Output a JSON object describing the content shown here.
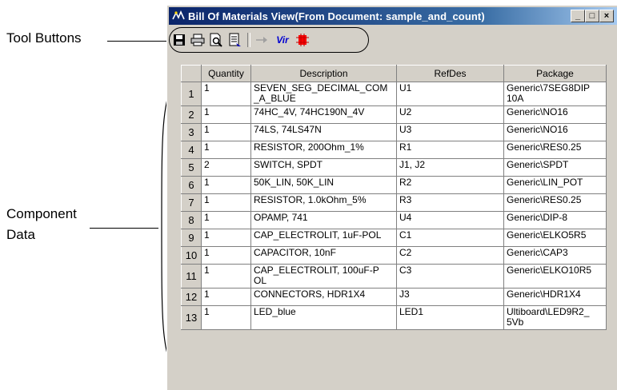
{
  "annotations": {
    "tool_buttons": "Tool Buttons",
    "component_data_line1": "Component",
    "component_data_line2": "Data"
  },
  "window": {
    "title": "Bill Of Materials View(From Document: sample_and_count)",
    "controls": {
      "minimize": "_",
      "maximize": "□",
      "close": "×"
    }
  },
  "toolbar": {
    "buttons": [
      {
        "name": "save-icon"
      },
      {
        "name": "print-icon"
      },
      {
        "name": "print-preview-icon"
      },
      {
        "name": "export-icon"
      },
      {
        "name": "arrow-icon"
      },
      {
        "name": "virtual-icon",
        "label": "Vir"
      },
      {
        "name": "component-icon"
      }
    ]
  },
  "table": {
    "columns": [
      "Quantity",
      "Description",
      "RefDes",
      "Package"
    ],
    "rows": [
      {
        "num": "1",
        "qty": "1",
        "desc": "SEVEN_SEG_DECIMAL_COM\n_A_BLUE",
        "ref": "U1",
        "pkg": "Generic\\7SEG8DIP\n10A"
      },
      {
        "num": "2",
        "qty": "1",
        "desc": "74HC_4V, 74HC190N_4V",
        "ref": "U2",
        "pkg": "Generic\\NO16"
      },
      {
        "num": "3",
        "qty": "1",
        "desc": "74LS, 74LS47N",
        "ref": "U3",
        "pkg": "Generic\\NO16"
      },
      {
        "num": "4",
        "qty": "1",
        "desc": "RESISTOR, 200Ohm_1%",
        "ref": "R1",
        "pkg": "Generic\\RES0.25"
      },
      {
        "num": "5",
        "qty": "2",
        "desc": "SWITCH, SPDT",
        "ref": "J1, J2",
        "pkg": "Generic\\SPDT"
      },
      {
        "num": "6",
        "qty": "1",
        "desc": "50K_LIN, 50K_LIN",
        "ref": "R2",
        "pkg": "Generic\\LIN_POT"
      },
      {
        "num": "7",
        "qty": "1",
        "desc": "RESISTOR, 1.0kOhm_5%",
        "ref": "R3",
        "pkg": "Generic\\RES0.25"
      },
      {
        "num": "8",
        "qty": "1",
        "desc": "OPAMP, 741",
        "ref": "U4",
        "pkg": "Generic\\DIP-8"
      },
      {
        "num": "9",
        "qty": "1",
        "desc": "CAP_ELECTROLIT, 1uF-POL",
        "ref": "C1",
        "pkg": "Generic\\ELKO5R5"
      },
      {
        "num": "10",
        "qty": "1",
        "desc": "CAPACITOR, 10nF",
        "ref": "C2",
        "pkg": "Generic\\CAP3"
      },
      {
        "num": "11",
        "qty": "1",
        "desc": "CAP_ELECTROLIT, 100uF-P\nOL",
        "ref": "C3",
        "pkg": "Generic\\ELKO10R5"
      },
      {
        "num": "12",
        "qty": "1",
        "desc": "CONNECTORS, HDR1X4",
        "ref": "J3",
        "pkg": "Generic\\HDR1X4"
      },
      {
        "num": "13",
        "qty": "1",
        "desc": "LED_blue",
        "ref": "LED1",
        "pkg": "Ultiboard\\LED9R2_\n5Vb"
      }
    ]
  }
}
